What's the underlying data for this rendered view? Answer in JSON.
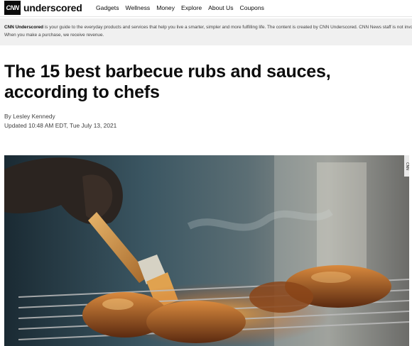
{
  "brand": {
    "cnn": "CNN",
    "wordmark": "underscored"
  },
  "nav": {
    "items": [
      {
        "label": "Gadgets"
      },
      {
        "label": "Wellness"
      },
      {
        "label": "Money"
      },
      {
        "label": "Explore"
      },
      {
        "label": "About Us"
      },
      {
        "label": "Coupons"
      }
    ]
  },
  "banner": {
    "brand": "CNN Underscored",
    "text": " is your guide to the everyday products and services that help you live a smarter, simpler and more fulfilling life. The content is created by CNN Underscored. CNN News staff is not involved. When you make a purchase, we receive revenue."
  },
  "article": {
    "title": "The 15 best barbecue rubs and sauces, according to chefs",
    "byline": "By Lesley Kennedy",
    "updated": "Updated 10:48 AM EDT, Tue July 13, 2021"
  },
  "hero": {
    "credit": "CNN"
  }
}
